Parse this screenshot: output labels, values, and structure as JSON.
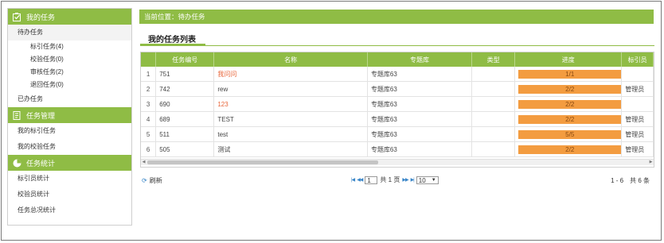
{
  "sidebar": {
    "sections": [
      {
        "title": "我的任务",
        "icon": "checkbox-icon"
      },
      {
        "title": "任务管理",
        "icon": "document-icon"
      },
      {
        "title": "任务统计",
        "icon": "pie-chart-icon"
      }
    ],
    "my_tasks": {
      "pending": "待办任务",
      "sub": [
        "标引任务(4)",
        "校验任务(0)",
        "审核任务(2)",
        "退回任务(0)"
      ],
      "done": "已办任务"
    },
    "manage": [
      "我的标引任务",
      "我的校验任务"
    ],
    "stats": [
      "标引员统计",
      "校验员统计",
      "任务总况统计"
    ]
  },
  "breadcrumb": "当前位置：待办任务",
  "panel_title": "我的任务列表",
  "table": {
    "columns": [
      "任务编号",
      "名称",
      "专题库",
      "类型",
      "进度",
      "标引员"
    ],
    "rows": [
      {
        "n": "1",
        "id": "751",
        "name": "我问问",
        "link": true,
        "lib": "专题库63",
        "type": "",
        "progress": "1/1",
        "fill": 1.0,
        "indexer": ""
      },
      {
        "n": "2",
        "id": "742",
        "name": "rew",
        "link": false,
        "lib": "专题库63",
        "type": "",
        "progress": "2/2",
        "fill": 1.0,
        "indexer": "管理员"
      },
      {
        "n": "3",
        "id": "690",
        "name": "123",
        "link": true,
        "lib": "专题库63",
        "type": "",
        "progress": "2/2",
        "fill": 1.0,
        "indexer": ""
      },
      {
        "n": "4",
        "id": "689",
        "name": "TEST",
        "link": false,
        "lib": "专题库63",
        "type": "",
        "progress": "2/2",
        "fill": 1.0,
        "indexer": "管理员"
      },
      {
        "n": "5",
        "id": "511",
        "name": "test",
        "link": false,
        "lib": "专题库63",
        "type": "",
        "progress": "5/5",
        "fill": 1.0,
        "indexer": "管理员"
      },
      {
        "n": "6",
        "id": "505",
        "name": "测试",
        "link": false,
        "lib": "专题库63",
        "type": "",
        "progress": "2/2",
        "fill": 1.0,
        "indexer": "管理员"
      }
    ]
  },
  "pager": {
    "refresh": "刷新",
    "page_value": "1",
    "total_pages": "共 1 页",
    "page_size": "10",
    "info": "1 - 6　共 6 条"
  },
  "colors": {
    "accent": "#8fbc45",
    "progress": "#f39c40",
    "link": "#e8663a"
  }
}
